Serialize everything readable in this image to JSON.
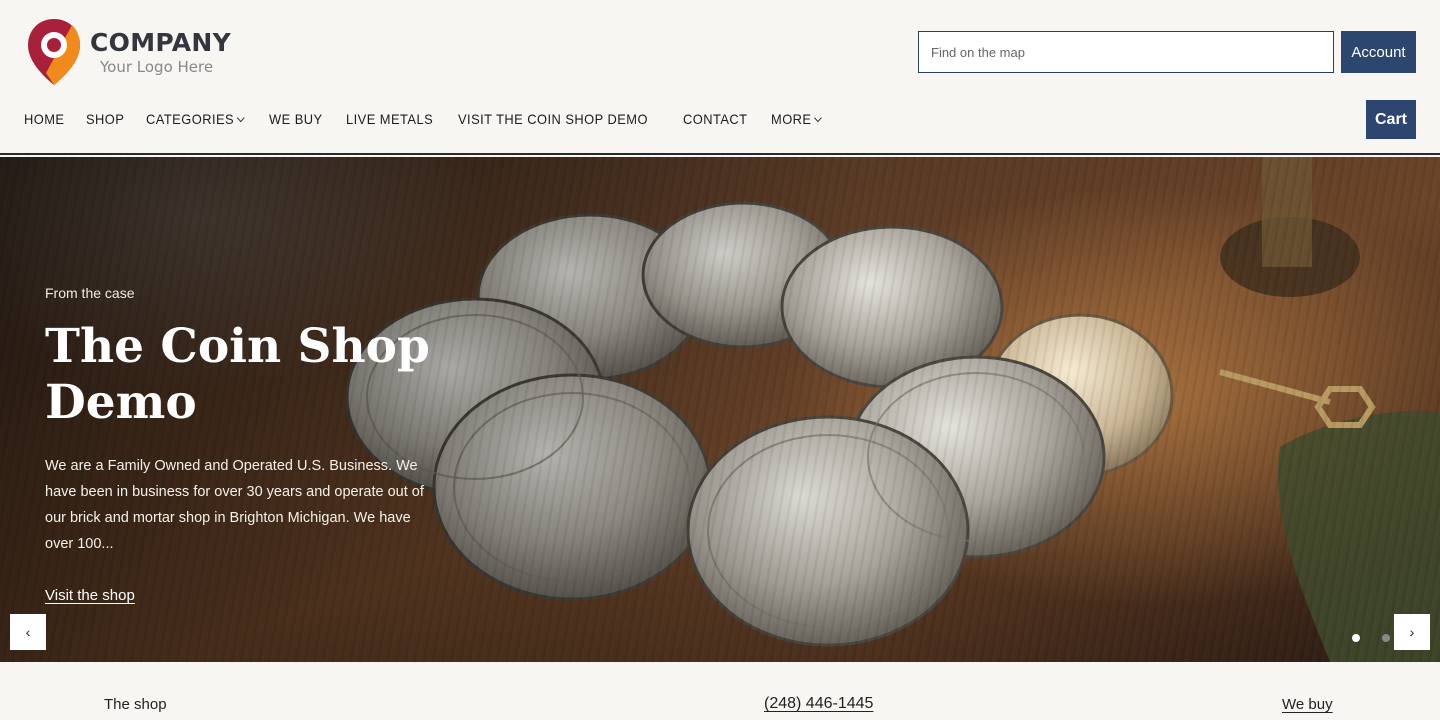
{
  "brand": {
    "name": "COMPANY",
    "tagline": "Your Logo Here",
    "primary_color": "#2c4670"
  },
  "header": {
    "search_placeholder": "Find on the map",
    "account_label": "Account",
    "cart_label": "Cart"
  },
  "nav": {
    "items": [
      {
        "label": "HOME",
        "dropdown": false
      },
      {
        "label": "SHOP",
        "dropdown": false
      },
      {
        "label": "CATEGORIES",
        "dropdown": true
      },
      {
        "label": "WE BUY",
        "dropdown": false
      },
      {
        "label": "LIVE METALS",
        "dropdown": false
      },
      {
        "label": "VISIT THE COIN SHOP DEMO",
        "dropdown": false
      },
      {
        "label": "CONTACT",
        "dropdown": false
      },
      {
        "label": "MORE",
        "dropdown": true
      }
    ]
  },
  "hero": {
    "eyebrow": "From the case",
    "title": "The Coin Shop Demo",
    "description": "We are a Family Owned and Operated U.S. Business. We have been in business for over 30 years and operate out of our brick and mortar shop in Brighton Michigan. We have over 100...",
    "link_label": "Visit the shop",
    "prev_icon": "‹",
    "next_icon": "›",
    "slide_count": 2,
    "active_slide": 1
  },
  "strip": {
    "shop_label": "The shop",
    "phone": "(248) 446-1445",
    "buy_label": "We buy"
  }
}
